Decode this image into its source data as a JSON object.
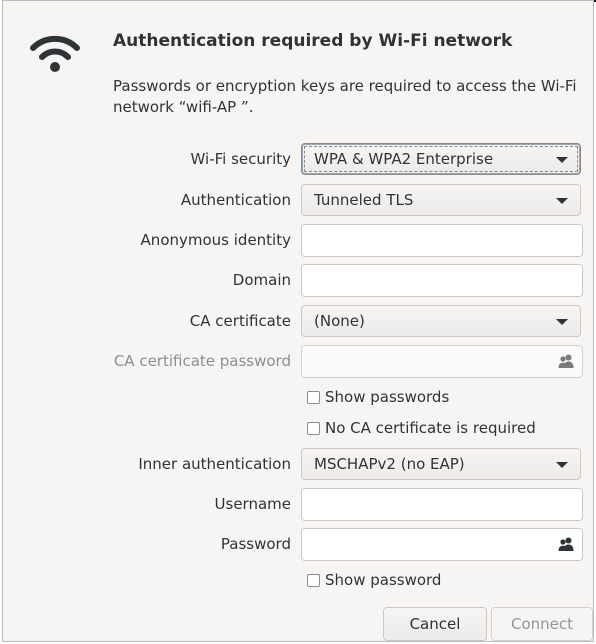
{
  "dialog": {
    "title": "Authentication required by Wi-Fi network",
    "description": "Passwords or encryption keys are required to access the Wi-Fi network “wifi-AP ”."
  },
  "form": {
    "wifi_security": {
      "label": "Wi-Fi security",
      "value": "WPA & WPA2 Enterprise"
    },
    "authentication": {
      "label": "Authentication",
      "value": "Tunneled TLS"
    },
    "anonymous_identity": {
      "label": "Anonymous identity",
      "value": ""
    },
    "domain": {
      "label": "Domain",
      "value": ""
    },
    "ca_certificate": {
      "label": "CA certificate",
      "value": "(None)"
    },
    "ca_certificate_password": {
      "label": "CA certificate password",
      "value": ""
    },
    "show_passwords": {
      "label": "Show passwords",
      "checked": false
    },
    "no_ca_required": {
      "label": "No CA certificate is required",
      "checked": false
    },
    "inner_authentication": {
      "label": "Inner authentication",
      "value": "MSCHAPv2 (no EAP)"
    },
    "username": {
      "label": "Username",
      "value": ""
    },
    "password": {
      "label": "Password",
      "value": ""
    },
    "show_password": {
      "label": "Show password",
      "checked": false
    }
  },
  "buttons": {
    "cancel": "Cancel",
    "connect": "Connect"
  },
  "icons": {
    "network": "wifi-icon",
    "user_selector": "users-icon"
  }
}
